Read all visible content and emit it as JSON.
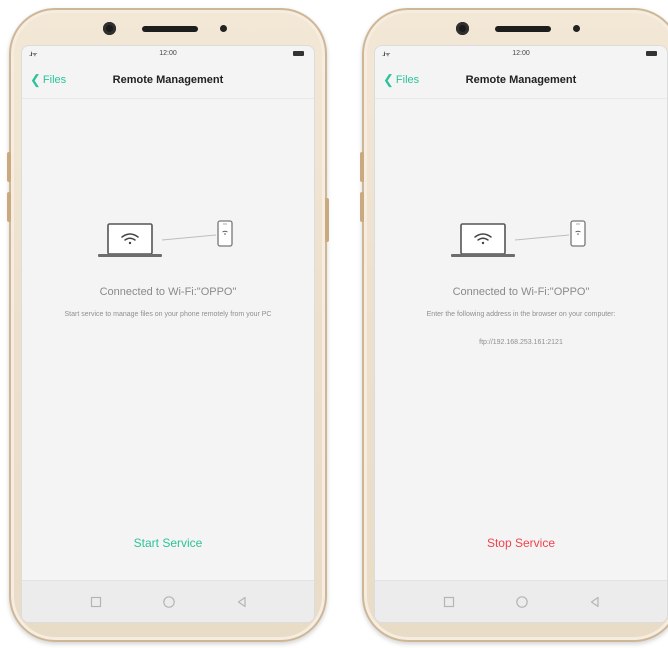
{
  "phones": [
    {
      "status": {
        "time": "12:00",
        "signal": "..ıl ᯤ"
      },
      "nav": {
        "back_label": "Files",
        "title": "Remote Management"
      },
      "connected": "Connected to Wi-Fi:\"OPPO\"",
      "description": "Start service to manage files on your phone remotely from your PC",
      "address": "",
      "button": {
        "label": "Start Service",
        "color": "#2cc39a"
      }
    },
    {
      "status": {
        "time": "12:00",
        "signal": "..ıl ᯤ"
      },
      "nav": {
        "back_label": "Files",
        "title": "Remote Management"
      },
      "connected": "Connected to Wi-Fi:\"OPPO\"",
      "description": "Enter the following address in the browser on your computer:",
      "address": "ftp://192.168.253.161:2121",
      "button": {
        "label": "Stop Service",
        "color": "#f0424d"
      }
    }
  ],
  "colors": {
    "accent": "#2cc39a",
    "danger": "#f0424d",
    "frame": "#ece0cd"
  },
  "icons": [
    "wifi-icon",
    "laptop-icon",
    "phone-icon",
    "recent-apps-icon",
    "home-icon",
    "back-icon"
  ]
}
